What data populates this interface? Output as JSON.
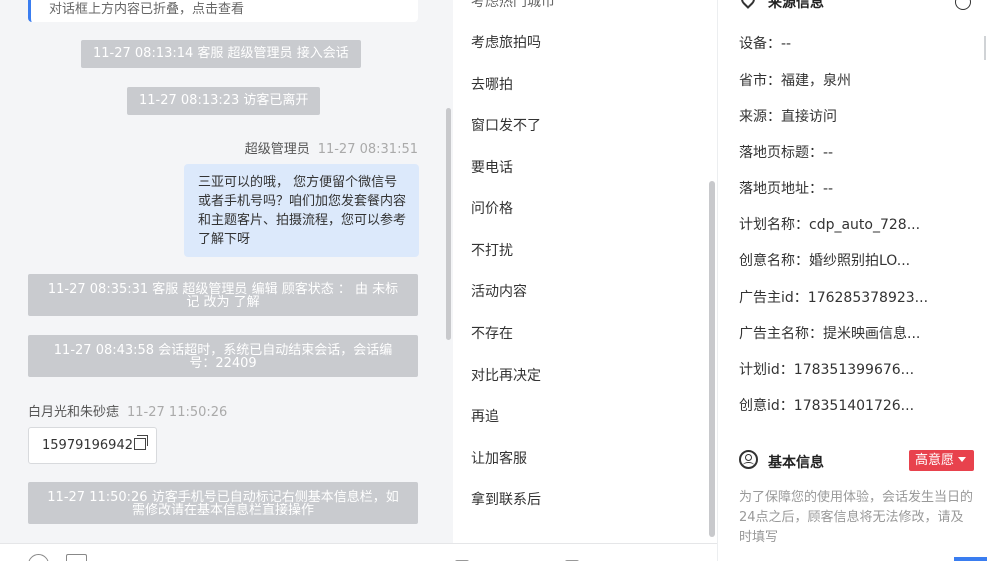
{
  "chat": {
    "top_message": "对话框上方内容已折叠，点击查看",
    "events": [
      "11-27 08:13:14 客服 超级管理员 接入会话",
      "11-27 08:13:23 访客已离开"
    ],
    "agent_name": "超级管理员",
    "agent_time": "11-27 08:31:51",
    "agent_message": "三亚可以的哦， 您方便留个微信号或者手机号吗？咱们加您发套餐内容和主题客片、拍摄流程，您可以参考了解下呀",
    "status_event": "11-27 08:35:31 客服 超级管理员 编辑 顾客状态 ： 由 未标记 改为 了解",
    "timeout_event": "11-27 08:43:58 会话超时，系统已自动结束会话，会话编号：22409",
    "visitor_name": "白月光和朱砂痣",
    "visitor_time": "11-27 11:50:26",
    "visitor_phone": "15979196942",
    "phone_event": "11-27 11:50:26 访客手机号已自动标记右侧基本信息栏，如需修改请在基本信息栏直接操作"
  },
  "quick_replies": {
    "items": [
      "考虑旅拍吗",
      "去哪拍",
      "窗口发不了",
      "要电话",
      "问价格",
      "不打扰",
      "活动内容",
      "不存在",
      "对比再决定",
      "再追",
      "让加客服",
      "拿到联系后"
    ]
  },
  "info": {
    "source_title": "来源信息",
    "rows": [
      {
        "label": "设备：",
        "value": "--"
      },
      {
        "label": "省市：",
        "value": "福建，泉州"
      },
      {
        "label": "来源：",
        "value": "直接访问"
      },
      {
        "label": "落地页标题：",
        "value": "--"
      },
      {
        "label": "落地页地址：",
        "value": "--"
      },
      {
        "label": "计划名称：",
        "value": "cdp_auto_728..."
      },
      {
        "label": "创意名称：",
        "value": "婚纱照别拍LO..."
      },
      {
        "label": "广告主id：",
        "value": "176285378923..."
      },
      {
        "label": "广告主名称：",
        "value": "提米映画信息..."
      },
      {
        "label": "计划id：",
        "value": "178351399676..."
      },
      {
        "label": "创意id：",
        "value": "178351401726..."
      }
    ],
    "basic_title": "基本信息",
    "intent_badge": "高意愿",
    "notice": "为了保障您的使用体验，会话发生当日的24点之后，顾客信息将无法修改，请及时填写"
  },
  "icons": {
    "source": "map-pin-icon",
    "basic": "user-circle-icon",
    "copy": "copy-icon"
  },
  "colors": {
    "accent": "#3a7df0",
    "badge": "#e8424d",
    "system_msg": "#c9cbcf",
    "agent_bubble": "#dce9fb"
  }
}
